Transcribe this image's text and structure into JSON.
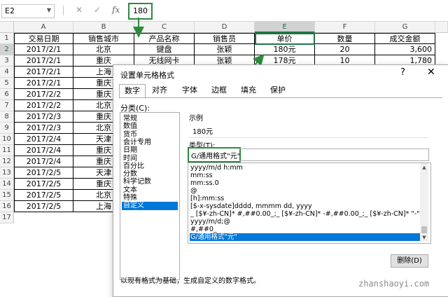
{
  "formula_bar": {
    "name_box": "E2",
    "cancel_icon": "✕",
    "confirm_icon": "✓",
    "fx_label": "fx",
    "value": "180"
  },
  "sheet": {
    "columns": [
      "A",
      "B",
      "C",
      "D",
      "E",
      "F",
      "G"
    ],
    "selected_column": "E",
    "selected_row": "2",
    "row_numbers": [
      "1",
      "2",
      "3",
      "4",
      "5",
      "6",
      "7",
      "8",
      "9",
      "10",
      "11",
      "12",
      "13",
      "14",
      "15",
      "16",
      "17"
    ],
    "headers": [
      "交易日期",
      "销售城市",
      "产品名称",
      "销售员",
      "单价",
      "数量",
      "成交金额"
    ],
    "rows": [
      [
        "2017/2/1",
        "北京",
        "键盘",
        "张颖",
        "180元",
        "20",
        "3,600"
      ],
      [
        "2017/2/1",
        "重庆",
        "无线网卡",
        "张颖",
        "178元",
        "10",
        "1,780"
      ],
      [
        "2017/2/1",
        "上海"
      ],
      [
        "2017/2/1",
        "重庆"
      ],
      [
        "2017/2/2",
        "重庆"
      ],
      [
        "2017/2/2",
        "北京"
      ],
      [
        "2017/2/3",
        "重庆"
      ],
      [
        "2017/2/3",
        "北京"
      ],
      [
        "2017/2/4",
        "天津"
      ],
      [
        "2017/2/4",
        "重庆"
      ],
      [
        "2017/2/4",
        "重庆"
      ],
      [
        "2017/2/5",
        "天津"
      ],
      [
        "2017/2/5",
        "重庆"
      ],
      [
        "2017/2/5",
        "北京"
      ],
      [
        "2017/2/5",
        "上海"
      ]
    ]
  },
  "dialog": {
    "title": "设置单元格格式",
    "help": "?",
    "close": "✕",
    "tabs": [
      "数字",
      "对齐",
      "字体",
      "边框",
      "填充",
      "保护"
    ],
    "active_tab": "数字",
    "category_label": "分类(C):",
    "categories": [
      "常规",
      "数值",
      "货币",
      "会计专用",
      "日期",
      "时间",
      "百分比",
      "分数",
      "科学记数",
      "文本",
      "特殊",
      "自定义"
    ],
    "selected_category": "自定义",
    "sample_label": "示例",
    "sample_value": "180元",
    "type_label": "类型(T):",
    "type_value": "G/通用格式\"元\"",
    "formats": [
      "yyyy/m/d h:mm",
      "mm:ss",
      "mm:ss.0",
      "@",
      "[h]:mm:ss",
      "[$-x-sysdate]dddd, mmmm dd, yyyy",
      "_ [$¥-zh-CN]* #,##0.00_;_ [$¥-zh-CN]* -#,##0.00_;_ [$¥-zh-CN]* \"-\"??_;_ @_",
      "yyyy/m/d;@",
      "#,##0_",
      "G/通用格式\"元\""
    ],
    "selected_format": "G/通用格式\"元\"",
    "delete_button": "删除(D)",
    "description": "以现有格式为基础，生成自定义的数字格式。"
  },
  "watermark": "zhanshaoyi.com"
}
